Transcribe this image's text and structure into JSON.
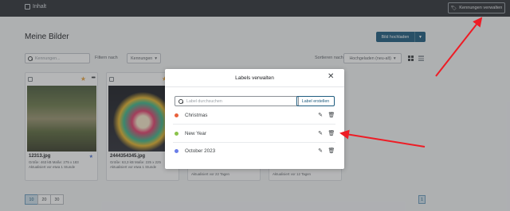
{
  "topbar": {
    "section_label": "Inhalt",
    "manage_keywords_label": "Kennungen verwalten"
  },
  "page": {
    "title": "Meine Bilder",
    "upload_label": "Bild hochladen"
  },
  "filters": {
    "search_placeholder": "Kennungen...",
    "filter_label": "Filtern nach",
    "filter_value": "Kennungen",
    "sort_label": "Sortieren nach",
    "sort_value": "Hochgeladen (neu-alt)"
  },
  "cards": [
    {
      "filename": "12313.jpg",
      "meta": "Größe: 463 kB   Maße: 275 x 183",
      "updated": "Aktualisiert vor etwa 1 Stunde",
      "starred": true
    },
    {
      "filename": "2444354345.jpg",
      "meta": "Größe: 63,3 kB   Maße: 225 x 225",
      "updated": "Aktualisiert vor etwa 1 Stunde",
      "starred": true
    },
    {
      "updated": "Aktualisiert vor 22 Tagen"
    },
    {
      "updated": "Aktualisiert vor 12 Tagen"
    }
  ],
  "pagination": {
    "page_sizes": [
      "10",
      "20",
      "30"
    ],
    "active_size": "10",
    "current_page": "1"
  },
  "modal": {
    "title": "Labels verwalten",
    "search_placeholder": "Label durchsuchen",
    "create_label": "Label erstellen",
    "labels": [
      {
        "name": "Christmas",
        "color": "#e8613c"
      },
      {
        "name": "New Year",
        "color": "#8bc34a"
      },
      {
        "name": "October 2023",
        "color": "#6a7ee8"
      }
    ]
  },
  "colors": {
    "primary": "#1d5b7e",
    "annotation": "#ee1c25"
  }
}
